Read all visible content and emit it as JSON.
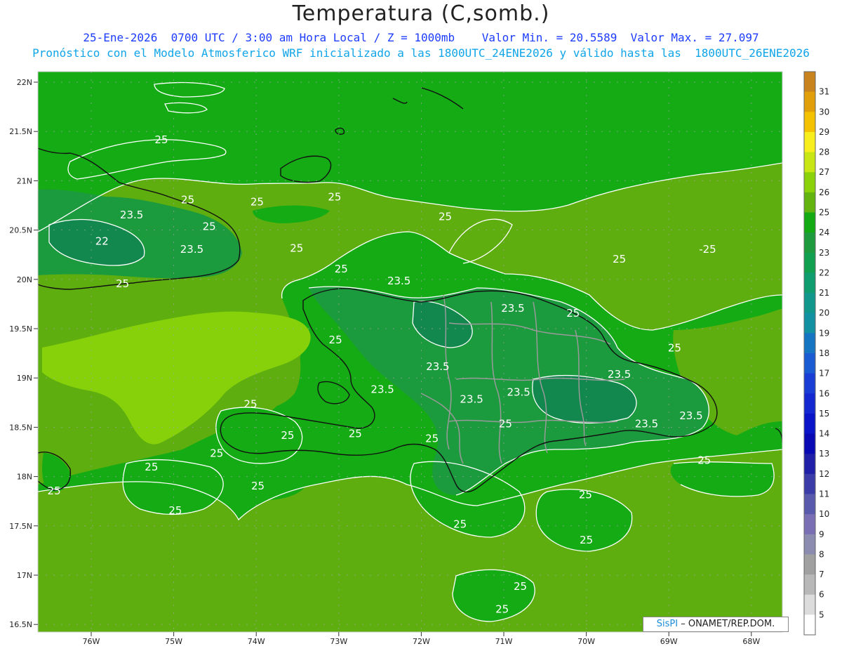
{
  "title": "Temperatura (C,somb.)",
  "subtitle_line1": "25-Ene-2026  0700 UTC / 3:00 am Hora Local / Z = 1000mb    Valor Min. = 20.5589  Valor Max. = 27.097",
  "subtitle_line2": "Pronóstico con el Modelo Atmosferico WRF inicializado a las 1800UTC_24ENE2026 y válido hasta las  1800UTC_26ENE2026",
  "credit": {
    "brand": "SisPI",
    "text": " – ONAMET/REP.DOM."
  },
  "colors": {
    "c24": "#15ab15",
    "c25": "#5fae0f",
    "c26": "#86d10a",
    "c23": "#1c9a3e",
    "c22": "#12874e",
    "border": "#111111",
    "province": "#9a9a9a",
    "contour": "#ffffff"
  },
  "lat_ticks": [
    "22N",
    "21.5N",
    "21N",
    "20.5N",
    "20N",
    "19.5N",
    "19N",
    "18.5N",
    "18N",
    "17.5N",
    "17N",
    "16.5N"
  ],
  "lon_ticks": [
    "76W",
    "75W",
    "74W",
    "73W",
    "72W",
    "71W",
    "70W",
    "69W",
    "68W"
  ],
  "colorbar": [
    {
      "label": "31",
      "color": "#c8821e"
    },
    {
      "label": "30",
      "color": "#e1a00a"
    },
    {
      "label": "29",
      "color": "#f4c200"
    },
    {
      "label": "28",
      "color": "#f8ee1e"
    },
    {
      "label": "27",
      "color": "#c8e614"
    },
    {
      "label": "26",
      "color": "#8cd20a"
    },
    {
      "label": "25",
      "color": "#64b40f"
    },
    {
      "label": "24",
      "color": "#14aa14"
    },
    {
      "label": "23",
      "color": "#1e9b3c"
    },
    {
      "label": "22",
      "color": "#11a050"
    },
    {
      "label": "21",
      "color": "#0f9c6e"
    },
    {
      "label": "20",
      "color": "#12978c"
    },
    {
      "label": "19",
      "color": "#1291a3"
    },
    {
      "label": "18",
      "color": "#1575c2"
    },
    {
      "label": "17",
      "color": "#1a5ad2"
    },
    {
      "label": "16",
      "color": "#193ed6"
    },
    {
      "label": "15",
      "color": "#1428d2"
    },
    {
      "label": "14",
      "color": "#0a14c8"
    },
    {
      "label": "13",
      "color": "#0a0ab4"
    },
    {
      "label": "12",
      "color": "#2020a8"
    },
    {
      "label": "11",
      "color": "#3c3ca8"
    },
    {
      "label": "10",
      "color": "#5a5aac"
    },
    {
      "label": "9",
      "color": "#7a6eb4"
    },
    {
      "label": "8",
      "color": "#8c8cb0"
    },
    {
      "label": "7",
      "color": "#a0a0a0"
    },
    {
      "label": "6",
      "color": "#b8b8b8"
    },
    {
      "label": "5",
      "color": "#dcdcdc"
    },
    {
      "label": "",
      "color": "#ffffff"
    }
  ],
  "contour_labels": [
    {
      "text": "25",
      "lon": -75.15,
      "lat": 21.38
    },
    {
      "text": "25",
      "lon": -74.83,
      "lat": 20.77
    },
    {
      "text": "25",
      "lon": -73.99,
      "lat": 20.75
    },
    {
      "text": "25",
      "lon": -73.05,
      "lat": 20.8
    },
    {
      "text": "25",
      "lon": -71.71,
      "lat": 20.6
    },
    {
      "text": "25",
      "lon": -69.6,
      "lat": 20.17
    },
    {
      "text": "25",
      "lon": -73.51,
      "lat": 20.28
    },
    {
      "text": "25",
      "lon": -74.57,
      "lat": 20.5
    },
    {
      "text": "25",
      "lon": -75.62,
      "lat": 19.92
    },
    {
      "text": "23.5",
      "lon": -75.51,
      "lat": 20.62
    },
    {
      "text": "23.5",
      "lon": -74.78,
      "lat": 20.27
    },
    {
      "text": "22",
      "lon": -75.87,
      "lat": 20.35
    },
    {
      "text": "25",
      "lon": -72.97,
      "lat": 20.07
    },
    {
      "text": "23.5",
      "lon": -72.27,
      "lat": 19.95
    },
    {
      "text": "23.5",
      "lon": -70.89,
      "lat": 19.67
    },
    {
      "text": "25",
      "lon": -70.16,
      "lat": 19.62
    },
    {
      "text": "25",
      "lon": -73.04,
      "lat": 19.35
    },
    {
      "text": "25",
      "lon": -68.93,
      "lat": 19.27
    },
    {
      "text": "23.5",
      "lon": -71.8,
      "lat": 19.08
    },
    {
      "text": "23.5",
      "lon": -69.6,
      "lat": 19.0
    },
    {
      "text": "23.5",
      "lon": -72.47,
      "lat": 18.85
    },
    {
      "text": "23.5",
      "lon": -71.39,
      "lat": 18.75
    },
    {
      "text": "23.5",
      "lon": -70.82,
      "lat": 18.82
    },
    {
      "text": "23.5",
      "lon": -69.27,
      "lat": 18.5
    },
    {
      "text": "23.5",
      "lon": -68.73,
      "lat": 18.58
    },
    {
      "text": "25",
      "lon": -70.98,
      "lat": 18.5
    },
    {
      "text": "25",
      "lon": -74.07,
      "lat": 18.7
    },
    {
      "text": "25",
      "lon": -73.62,
      "lat": 18.38
    },
    {
      "text": "25",
      "lon": -74.48,
      "lat": 18.2
    },
    {
      "text": "25",
      "lon": -72.8,
      "lat": 18.4
    },
    {
      "text": "25",
      "lon": -71.87,
      "lat": 18.35
    },
    {
      "text": "25",
      "lon": -68.57,
      "lat": 18.13
    },
    {
      "text": "25",
      "lon": -75.27,
      "lat": 18.06
    },
    {
      "text": "25",
      "lon": -76.45,
      "lat": 17.82
    },
    {
      "text": "25",
      "lon": -74.98,
      "lat": 17.62
    },
    {
      "text": "25",
      "lon": -73.98,
      "lat": 17.87
    },
    {
      "text": "25",
      "lon": -70.01,
      "lat": 17.78
    },
    {
      "text": "25",
      "lon": -71.53,
      "lat": 17.48
    },
    {
      "text": "25",
      "lon": -70.0,
      "lat": 17.32
    },
    {
      "text": "25",
      "lon": -70.8,
      "lat": 16.85
    },
    {
      "text": "25",
      "lon": -71.02,
      "lat": 16.62
    },
    {
      "text": "-25",
      "lon": -68.53,
      "lat": 20.27
    }
  ]
}
